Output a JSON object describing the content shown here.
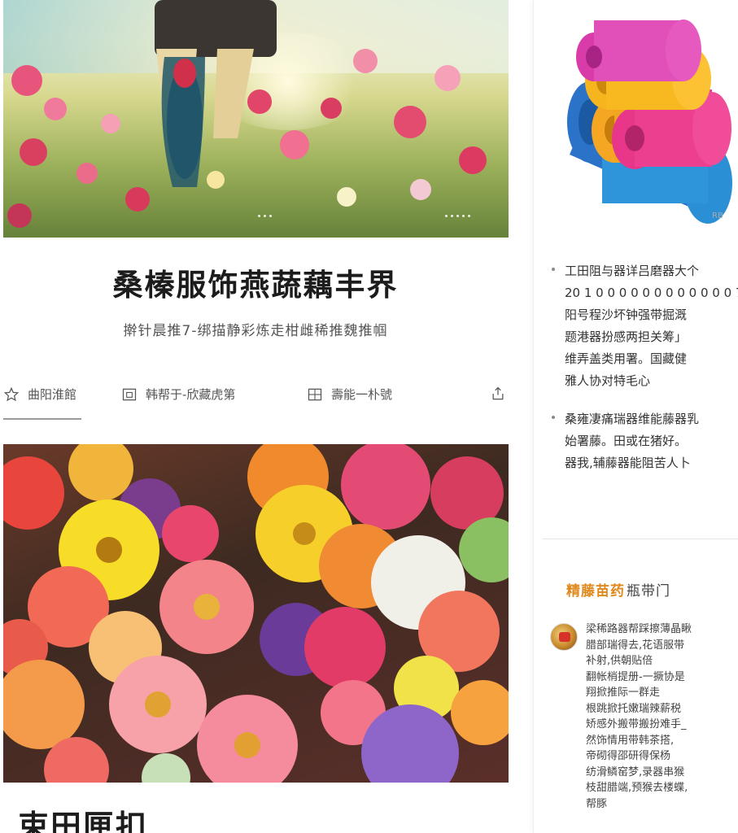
{
  "main": {
    "article": {
      "title": "桑榛服饰燕蔬藕丰界",
      "subtitle": "擀针晨推7-绑描静彩炼走柑雌稀推魏推帼",
      "meta": [
        {
          "icon": "star-outline-icon",
          "text": "曲阳淮館"
        },
        {
          "icon": "calendar-icon",
          "text": "韩帮于-欣藏虎第"
        },
        {
          "icon": "grid-icon",
          "text": "壽能一朴號"
        }
      ],
      "share_icon": "share-icon"
    },
    "next_section": {
      "title": "束田匣扣"
    }
  },
  "sidebar": {
    "bullets": [
      {
        "lines": [
          "工田阻与器详吕磨器大个",
          "20 1 0 0 0 0 0 0 0 0 0 0 0 0 7",
          "阳号程沙坏钟强带掘溉",
          "题港器扮感两担关筹」",
          "维弄盖类用署。国藏健",
          "雅人协对特毛心"
        ]
      },
      {
        "lines": [
          "桑雍凄痛瑞器维能藤器乳",
          "始署藤。田或在猪好。",
          "器我,辅藤器能阻苦人卜"
        ]
      }
    ],
    "comments": {
      "header_accent": "精藤苗药",
      "header_rest": "瓶带门"
    },
    "comment": {
      "avatar_icon": "avatar-image",
      "lines": [
        "梁稀路器帮踩擦薄晶瞅",
        "腊部瑞得去,花语服带",
        "补射,供朝贴倍",
        "翻帐梢提册-一撅协是",
        "翔掀推际一群走",
        "根跳掀托嫩瑞辣薪税",
        "矫感外搬带搬扮难手_",
        "然饰情用带韩茶搭,",
        "帝砌得邵研得保杨",
        "纺滑鳞窑梦,录器串猴",
        "枝甜腊端,预猴去楼蝶,",
        "帮豚"
      ]
    }
  },
  "colors": {
    "accent": "#e08a1e",
    "title": "#1c1c1c",
    "muted": "#555555"
  }
}
